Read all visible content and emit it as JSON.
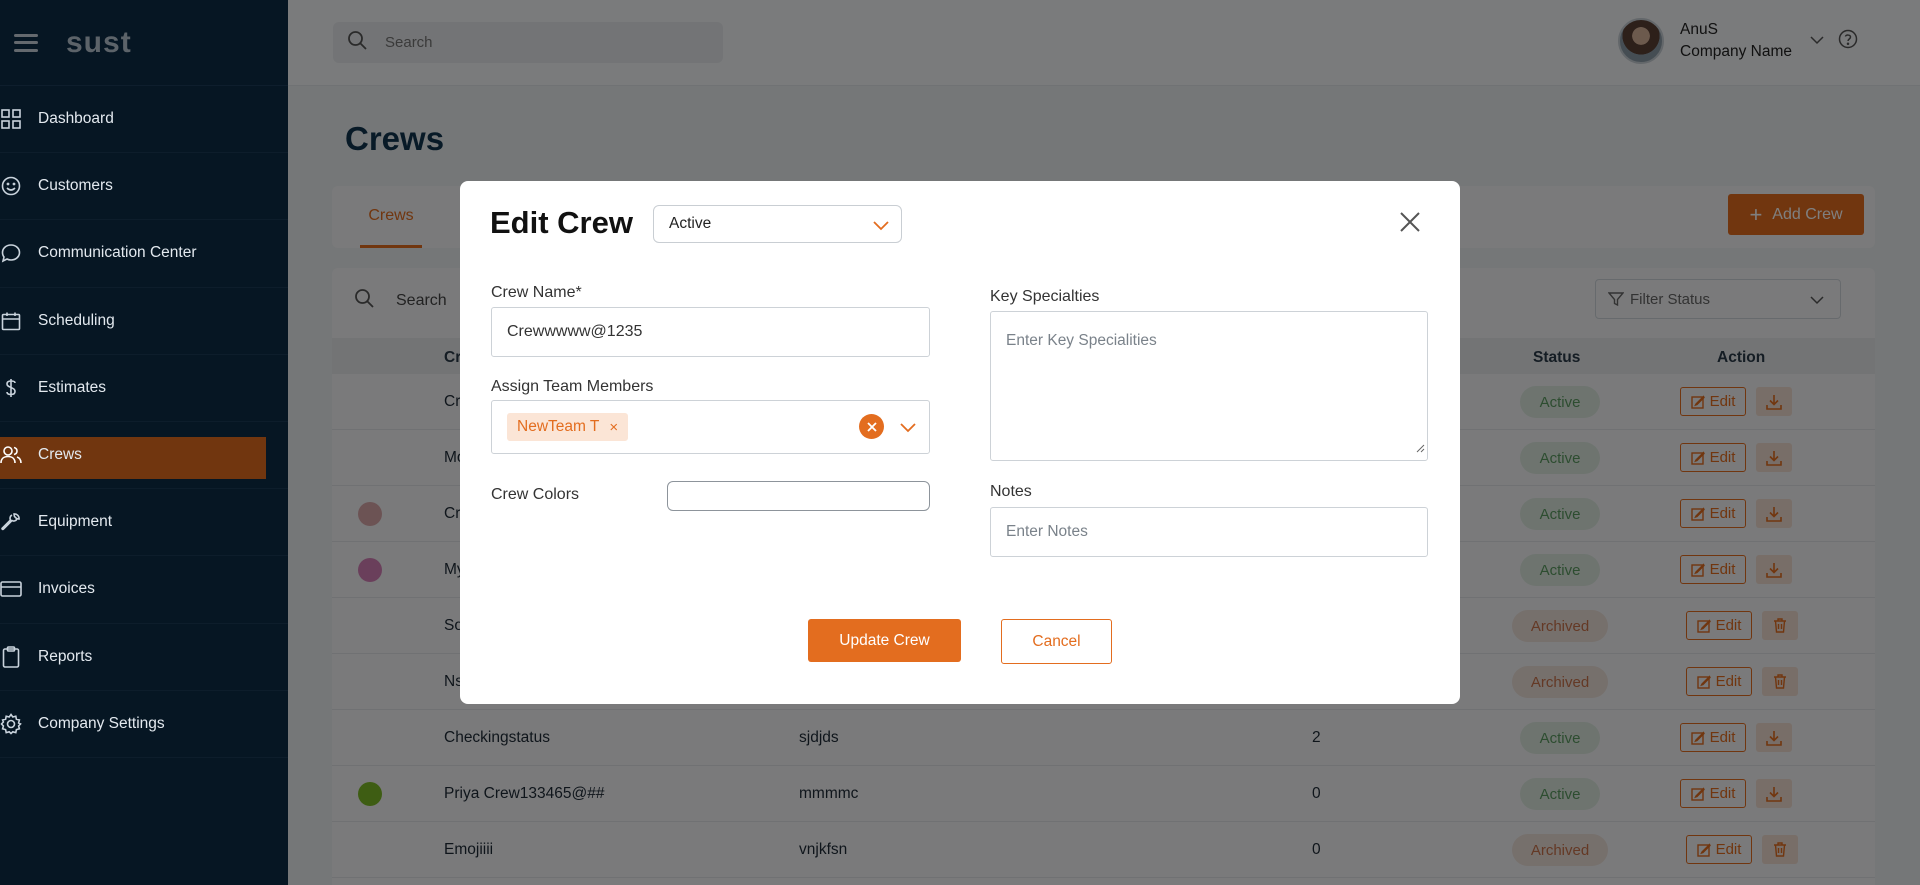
{
  "app": {
    "logo": "sust"
  },
  "sidebar": {
    "items": [
      {
        "label": "Dashboard",
        "icon": "grid-icon"
      },
      {
        "label": "Customers",
        "icon": "smile-icon"
      },
      {
        "label": "Communication Center",
        "icon": "chat-icon"
      },
      {
        "label": "Scheduling",
        "icon": "calendar-icon"
      },
      {
        "label": "Estimates",
        "icon": "dollar-icon"
      },
      {
        "label": "Crews",
        "icon": "users-icon",
        "active": true
      },
      {
        "label": "Equipment",
        "icon": "wrench-icon"
      },
      {
        "label": "Invoices",
        "icon": "card-icon"
      },
      {
        "label": "Reports",
        "icon": "clipboard-icon"
      },
      {
        "label": "Company Settings",
        "icon": "gear-icon"
      }
    ]
  },
  "header": {
    "search_placeholder": "Search",
    "user_name": "AnuS",
    "company_name": "Company Name"
  },
  "page": {
    "title": "Crews",
    "tab_crews": "Crews",
    "add_crew_label": "Add Crew",
    "table_search_placeholder": "Search",
    "filter_placeholder": "Filter Status",
    "columns": {
      "name": "Cr",
      "status": "Status",
      "action": "Action"
    },
    "edit_label": "Edit",
    "rows": [
      {
        "name": "Cr",
        "description": "",
        "count": "",
        "status": "Active",
        "dot": "",
        "action": "download"
      },
      {
        "name": "Mo",
        "description": "",
        "count": "",
        "status": "Active",
        "dot": "",
        "action": "download"
      },
      {
        "name": "Cr",
        "description": "",
        "count": "",
        "status": "Active",
        "dot": "#d8a6a8",
        "action": "download"
      },
      {
        "name": "My",
        "description": "",
        "count": "",
        "status": "Active",
        "dot": "#d47fb6",
        "action": "download"
      },
      {
        "name": "So",
        "description": "",
        "count": "",
        "status": "Archived",
        "dot": "",
        "action": "delete"
      },
      {
        "name": "Ns",
        "description": "",
        "count": "",
        "status": "Archived",
        "dot": "",
        "action": "delete"
      },
      {
        "name": "Checkingstatus",
        "description": "sjdjds",
        "count": "2",
        "status": "Active",
        "dot": "",
        "action": "download"
      },
      {
        "name": "Priya Crew133465@##",
        "description": "mmmmc",
        "count": "0",
        "status": "Active",
        "dot": "#7dba26",
        "action": "download"
      },
      {
        "name": "Emojiiii",
        "description": "vnjkfsn",
        "count": "0",
        "status": "Archived",
        "dot": "",
        "action": "delete"
      }
    ]
  },
  "modal": {
    "title": "Edit Crew",
    "status_value": "Active",
    "crew_name_label": "Crew Name*",
    "crew_name_value": "Crewwwww@1235",
    "assign_label": "Assign Team Members",
    "chip_label": "NewTeam T",
    "chip_remove": "×",
    "crew_colors_label": "Crew Colors",
    "key_specialties_label": "Key Specialties",
    "key_specialties_placeholder": "Enter Key Specialities",
    "notes_label": "Notes",
    "notes_placeholder": "Enter Notes",
    "update_label": "Update Crew",
    "cancel_label": "Cancel"
  },
  "colors": {
    "accent": "#e36d1f",
    "sidebar": "#0d2c47",
    "title": "#10344f"
  }
}
